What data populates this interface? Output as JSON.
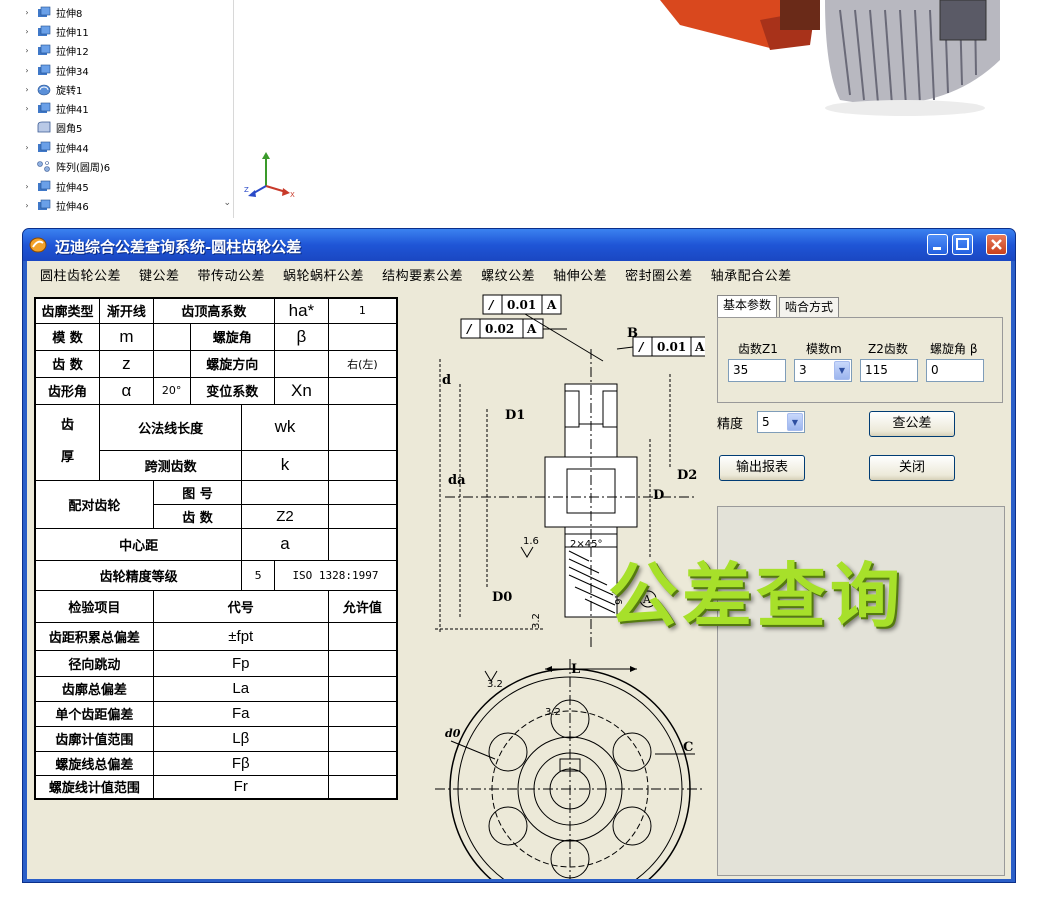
{
  "tree": {
    "items": [
      {
        "label": "拉伸8",
        "icon": "extrude-icon",
        "expandable": true
      },
      {
        "label": "拉伸11",
        "icon": "extrude-icon",
        "expandable": true
      },
      {
        "label": "拉伸12",
        "icon": "extrude-icon",
        "expandable": true
      },
      {
        "label": "拉伸34",
        "icon": "extrude-icon",
        "expandable": true
      },
      {
        "label": "旋转1",
        "icon": "revolve-icon",
        "expandable": true
      },
      {
        "label": "拉伸41",
        "icon": "extrude-icon",
        "expandable": true
      },
      {
        "label": "圆角5",
        "icon": "fillet-icon",
        "expandable": false
      },
      {
        "label": "拉伸44",
        "icon": "extrude-icon",
        "expandable": true
      },
      {
        "label": "阵列(圆周)6",
        "icon": "pattern-icon",
        "expandable": false
      },
      {
        "label": "拉伸45",
        "icon": "extrude-icon",
        "expandable": true
      },
      {
        "label": "拉伸46",
        "icon": "extrude-icon",
        "expandable": true
      }
    ]
  },
  "window": {
    "title": "迈迪综合公差查询系统-圆柱齿轮公差",
    "menu": [
      "圆柱齿轮公差",
      "键公差",
      "带传动公差",
      "蜗轮蜗杆公差",
      "结构要素公差",
      "螺纹公差",
      "轴伸公差",
      "密封圈公差",
      "轴承配合公差"
    ]
  },
  "table": {
    "profile_type_label": "齿廓类型",
    "profile_type_value": "渐开线",
    "addendum_label": "齿顶高系数",
    "addendum_symbol": "ha*",
    "addendum_value": "1",
    "module_label": "模 数",
    "module_symbol": "m",
    "helix_angle_label": "螺旋角",
    "helix_angle_symbol": "β",
    "teeth_label": "齿 数",
    "teeth_symbol": "z",
    "helix_dir_label": "螺旋方向",
    "helix_dir_value": "右(左)",
    "pressure_angle_label": "齿形角",
    "pressure_angle_symbol": "α",
    "pressure_angle_value": "20°",
    "shift_label": "变位系数",
    "shift_symbol": "Xn",
    "tooth_label_top": "齿",
    "tooth_label_bottom": "厚",
    "wk_label": "公法线长度",
    "wk_symbol": "wk",
    "k_label": "跨测齿数",
    "k_symbol": "k",
    "mating_label": "配对齿轮",
    "drawing_no_label": "图 号",
    "mating_teeth_label": "齿 数",
    "mating_teeth_symbol": "Z2",
    "center_label": "中心距",
    "center_symbol": "a",
    "accuracy_label": "齿轮精度等级",
    "accuracy_value": "5",
    "accuracy_std": "ISO 1328:1997",
    "check_header": "检验项目",
    "code_header": "代号",
    "allow_header": "允许值",
    "checks": [
      {
        "name": "齿距积累总偏差",
        "code": "±fpt"
      },
      {
        "name": "径向跳动",
        "code": "Fp"
      },
      {
        "name": "齿廓总偏差",
        "code": "La"
      },
      {
        "name": "单个齿距偏差",
        "code": "Fa"
      },
      {
        "name": "齿廓计值范围",
        "code": "Lβ"
      },
      {
        "name": "螺旋线总偏差",
        "code": "Fβ"
      },
      {
        "name": "螺旋线计值范围",
        "code": "Fr"
      }
    ]
  },
  "drawing": {
    "tol1": "0.01",
    "tol2": "0.02",
    "tol3": "0.01",
    "datum": "A",
    "d": "d",
    "da": "da",
    "D1": "D1",
    "D2": "D2",
    "D": "D",
    "D0": "D0",
    "B": "B",
    "L": "L",
    "C": "C",
    "rough1": "1.6",
    "rough2": "3.2",
    "rough3": "3.2",
    "rough4": "3.2",
    "rough5": "1.6",
    "chamfer": "2×45°",
    "d0": "d0"
  },
  "panel": {
    "tab_basic": "基本参数",
    "tab_mesh": "啮合方式",
    "z1_label": "齿数Z1",
    "z1_value": "35",
    "module_label": "模数m",
    "module_value": "3",
    "z2_label": "Z2齿数",
    "z2_value": "115",
    "beta_label": "螺旋角 β",
    "beta_value": "0",
    "precision_label": "精度",
    "precision_value": "5",
    "query_button": "查公差",
    "export_button": "输出报表",
    "close_button": "关闭"
  },
  "watermark": "公差查询"
}
